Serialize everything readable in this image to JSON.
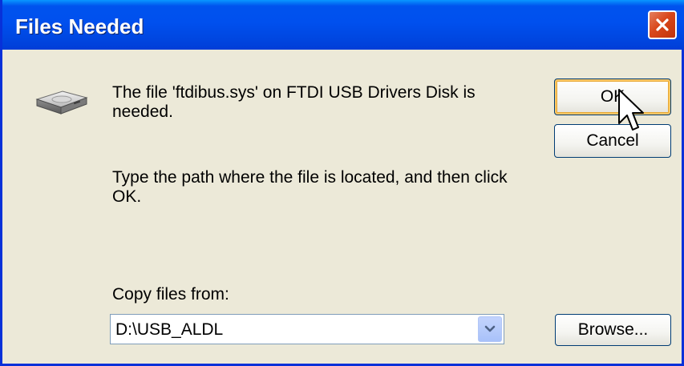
{
  "window": {
    "title": "Files Needed"
  },
  "message": {
    "line1": "The file 'ftdibus.sys' on FTDI USB Drivers Disk is needed.",
    "line2": "Type the path where the file is located, and then click OK."
  },
  "copy_from": {
    "label": "Copy files from:",
    "value": "D:\\USB_ALDL"
  },
  "buttons": {
    "ok": "OK",
    "cancel": "Cancel",
    "browse": "Browse..."
  },
  "icons": {
    "disk": "disk-drive-icon",
    "close": "close-icon",
    "dropdown": "chevron-down-icon",
    "cursor": "mouse-pointer-icon"
  },
  "colors": {
    "titlebar": "#0053EE",
    "dialog_bg": "#ECE9D8",
    "close_button": "#D9471A",
    "default_button_focus": "#F9C766"
  }
}
